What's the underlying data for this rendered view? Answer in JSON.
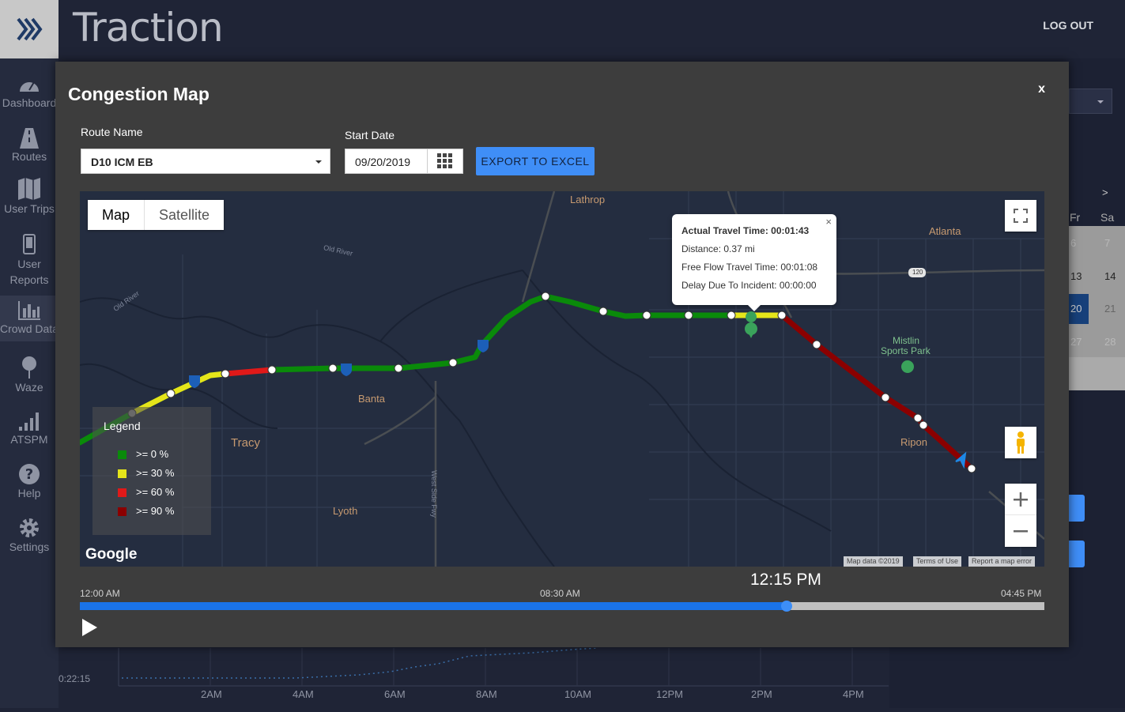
{
  "app": {
    "brand": "Traction",
    "logout_label": "LOG OUT"
  },
  "sidebar": {
    "items": [
      {
        "label": "Dashboard",
        "icon": "dashboard-gauge-icon"
      },
      {
        "label": "Routes",
        "icon": "road-icon"
      },
      {
        "label": "User Trips",
        "icon": "map-icon"
      },
      {
        "label": "User Reports",
        "icon": "phone-icon"
      },
      {
        "label": "Crowd Data",
        "icon": "bar-chart-icon"
      },
      {
        "label": "Waze",
        "icon": "pin-icon"
      },
      {
        "label": "ATSPM",
        "icon": "signal-bars-icon"
      },
      {
        "label": "Help",
        "icon": "help-icon"
      },
      {
        "label": "Settings",
        "icon": "gear-icon"
      }
    ]
  },
  "background": {
    "calendar": {
      "next": ">",
      "headers": [
        "Fr",
        "Sa"
      ],
      "days": [
        "6",
        "7",
        "13",
        "14",
        "20",
        "21",
        "27",
        "28"
      ]
    },
    "chart": {
      "y_label": "0:22:15",
      "x_labels": [
        "2AM",
        "4AM",
        "6AM",
        "8AM",
        "10AM",
        "12PM",
        "2PM",
        "4PM"
      ]
    }
  },
  "modal": {
    "title": "Congestion Map",
    "close_label": "x",
    "route_name_label": "Route Name",
    "route_value": "D10 ICM EB",
    "start_date_label": "Start Date",
    "start_date_value": "09/20/2019",
    "export_label": "EXPORT TO EXCEL"
  },
  "map": {
    "type_map": "Map",
    "type_satellite": "Satellite",
    "places": [
      "Lathrop",
      "Atlanta",
      "Banta",
      "Tracy",
      "Lyoth",
      "Mistlin",
      "Sports Park",
      "Ripon"
    ],
    "roads": [
      "Old River",
      "Old River",
      "West Side Fwy",
      "120"
    ],
    "legend": {
      "title": "Legend",
      "items": [
        {
          "label": ">= 0 %",
          "color": "#0a8a0a"
        },
        {
          "label": ">= 30 %",
          "color": "#e5e51a"
        },
        {
          "label": ">= 60 %",
          "color": "#e01919"
        },
        {
          "label": ">= 90 %",
          "color": "#8b0000"
        }
      ]
    },
    "info": {
      "close": "×",
      "actual": "Actual Travel Time: 00:01:43",
      "distance": "Distance: 0.37 mi",
      "free_flow": "Free Flow Travel Time: 00:01:08",
      "delay": "Delay Due To Incident: 00:00:00"
    },
    "google": "Google",
    "attribution": [
      "Map data ©2019",
      "Terms of Use",
      "Report a map error"
    ]
  },
  "timeline": {
    "current": "12:15 PM",
    "start": "12:00 AM",
    "mid": "08:30 AM",
    "end": "04:45 PM",
    "progress": 0.733
  }
}
